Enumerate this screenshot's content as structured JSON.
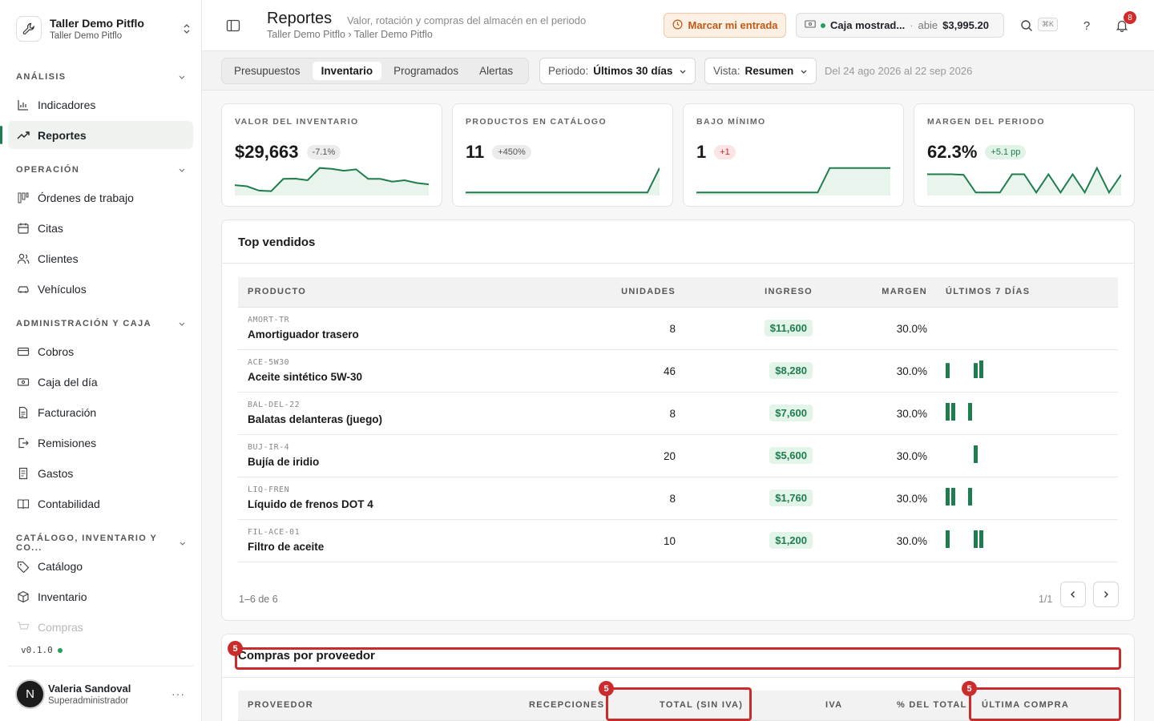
{
  "org": {
    "name": "Taller Demo Pitflo",
    "sub": "Taller Demo Pitflo"
  },
  "nav": {
    "sections": [
      {
        "label": "ANÁLISIS"
      },
      {
        "label": "OPERACIÓN"
      },
      {
        "label": "ADMINISTRACIÓN Y CAJA"
      },
      {
        "label": "CATÁLOGO, INVENTARIO Y CO..."
      }
    ],
    "items": [
      {
        "label": "Indicadores",
        "icon": "bar-chart-icon"
      },
      {
        "label": "Reportes",
        "icon": "trend-icon"
      },
      {
        "label": "Órdenes de trabajo",
        "icon": "kanban-icon"
      },
      {
        "label": "Citas",
        "icon": "calendar-icon"
      },
      {
        "label": "Clientes",
        "icon": "users-icon"
      },
      {
        "label": "Vehículos",
        "icon": "car-icon"
      },
      {
        "label": "Cobros",
        "icon": "card-icon"
      },
      {
        "label": "Caja del día",
        "icon": "cash-icon"
      },
      {
        "label": "Facturación",
        "icon": "invoice-icon"
      },
      {
        "label": "Remisiones",
        "icon": "export-icon"
      },
      {
        "label": "Gastos",
        "icon": "receipt-icon"
      },
      {
        "label": "Contabilidad",
        "icon": "book-icon"
      },
      {
        "label": "Catálogo",
        "icon": "tag-icon"
      },
      {
        "label": "Inventario",
        "icon": "box-icon"
      },
      {
        "label": "Compras",
        "icon": "cart-icon"
      }
    ]
  },
  "version": "v0.1.0",
  "user": {
    "initial": "N",
    "name": "Valeria Sandoval",
    "role": "Superadministrador",
    "more": "···"
  },
  "header": {
    "title": "Reportes",
    "subtitle": "Valor, rotación y compras del almacén en el periodo",
    "breadcrumb": "Taller Demo Pitflo › Taller Demo Pitflo",
    "entry_button": "Marcar mi entrada",
    "caja": {
      "name": "Caja mostrad...",
      "sep": "·",
      "state": "abie",
      "amount": "$3,995.20"
    },
    "shortcut": "⌘K",
    "help": "?",
    "notifications": "8"
  },
  "toolbar": {
    "tabs": [
      "Presupuestos",
      "Inventario",
      "Programados",
      "Alertas"
    ],
    "active_tab": "Inventario",
    "periodo_label": "Periodo:",
    "periodo_value": "Últimos 30 días",
    "vista_label": "Vista:",
    "vista_value": "Resumen",
    "range": "Del 24 ago 2026 al 22 sep 2026"
  },
  "kpis": [
    {
      "label": "VALOR DEL INVENTARIO",
      "value": "$29,663",
      "delta": "-7.1%",
      "tone": "gray",
      "spark": [
        0.32,
        0.28,
        0.12,
        0.1,
        0.55,
        0.56,
        0.5,
        0.95,
        0.92,
        0.85,
        0.9,
        0.55,
        0.55,
        0.45,
        0.5,
        0.4,
        0.35
      ]
    },
    {
      "label": "PRODUCTOS EN CATÁLOGO",
      "value": "11",
      "delta": "+450%",
      "tone": "gray",
      "spark": [
        0.05,
        0.05,
        0.05,
        0.05,
        0.05,
        0.05,
        0.05,
        0.05,
        0.05,
        0.05,
        0.05,
        0.05,
        0.05,
        0.05,
        0.05,
        0.05,
        0.95
      ]
    },
    {
      "label": "BAJO MÍNIMO",
      "value": "1",
      "delta": "+1",
      "tone": "red",
      "spark": [
        0.05,
        0.05,
        0.05,
        0.05,
        0.05,
        0.05,
        0.05,
        0.05,
        0.05,
        0.05,
        0.05,
        0.95,
        0.95,
        0.95,
        0.95,
        0.95,
        0.95
      ]
    },
    {
      "label": "MARGEN DEL PERIODO",
      "value": "62.3%",
      "delta": "+5.1 pp",
      "tone": "green",
      "spark": [
        0.72,
        0.72,
        0.72,
        0.7,
        0.05,
        0.05,
        0.05,
        0.72,
        0.72,
        0.05,
        0.72,
        0.05,
        0.72,
        0.05,
        0.95,
        0.05,
        0.7
      ]
    }
  ],
  "top_sellers": {
    "title": "Top vendidos",
    "columns": [
      "PRODUCTO",
      "UNIDADES",
      "INGRESO",
      "MARGEN",
      "ÚLTIMOS 7 DÍAS"
    ],
    "rows": [
      {
        "sku": "AMORT-TR",
        "name": "Amortiguador trasero",
        "units": "8",
        "income": "$11,600",
        "margin": "30.0%",
        "days": [
          0,
          0,
          0,
          0,
          0,
          0,
          0,
          0,
          0,
          0
        ]
      },
      {
        "sku": "ACE-5W30",
        "name": "Aceite sintético 5W-30",
        "units": "46",
        "income": "$8,280",
        "margin": "30.0%",
        "days": [
          0.8,
          0,
          0,
          0,
          0,
          0.8,
          1,
          0,
          0,
          0
        ]
      },
      {
        "sku": "BAL-DEL-22",
        "name": "Balatas delanteras (juego)",
        "units": "8",
        "income": "$7,600",
        "margin": "30.0%",
        "days": [
          1,
          1,
          0,
          0,
          1,
          0,
          0,
          0,
          0,
          0
        ]
      },
      {
        "sku": "BUJ-IR-4",
        "name": "Bujía de iridio",
        "units": "20",
        "income": "$5,600",
        "margin": "30.0%",
        "days": [
          0,
          0,
          0,
          0,
          0,
          1,
          0,
          0,
          0,
          0
        ]
      },
      {
        "sku": "LIQ-FREN",
        "name": "Líquido de frenos DOT 4",
        "units": "8",
        "income": "$1,760",
        "margin": "30.0%",
        "days": [
          1,
          1,
          0,
          0,
          1,
          0,
          0,
          0,
          0,
          0
        ]
      },
      {
        "sku": "FIL-ACE-01",
        "name": "Filtro de aceite",
        "units": "10",
        "income": "$1,200",
        "margin": "30.0%",
        "days": [
          1,
          0,
          0,
          0,
          0,
          1,
          1,
          0,
          0,
          0
        ]
      }
    ],
    "pager_info": "1–6 de 6",
    "pager_count": "1/1"
  },
  "purchases": {
    "title": "Compras por proveedor",
    "columns": [
      "PROVEEDOR",
      "RECEPCIONES",
      "TOTAL (SIN IVA)",
      "IVA",
      "% DEL TOTAL",
      "ÚLTIMA COMPRA"
    ]
  },
  "annotations": [
    "5",
    "5",
    "5"
  ],
  "colors": {
    "accent": "#1e7d4e",
    "alert": "#cc2b2b",
    "entry": "#c05a14"
  }
}
